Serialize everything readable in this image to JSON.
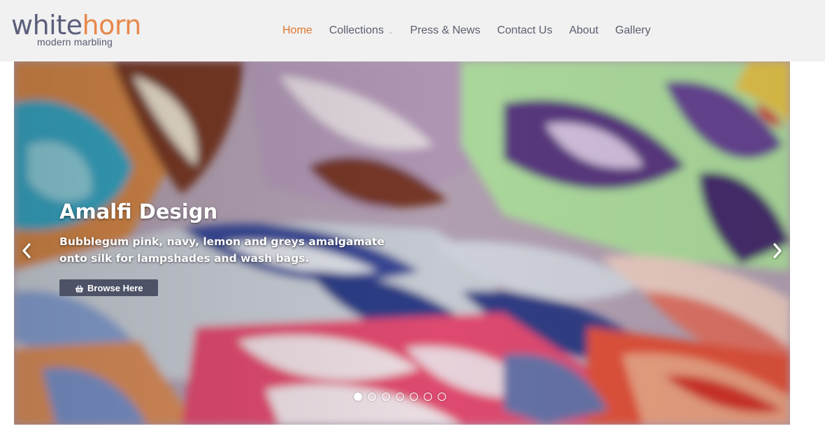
{
  "brand": {
    "name_part1": "white",
    "name_part2": "horn",
    "tagline": "modern marbling",
    "color_primary": "#5b5f7c",
    "color_accent": "#e8884a"
  },
  "nav": {
    "items": [
      {
        "label": "Home",
        "active": true
      },
      {
        "label": "Collections",
        "has_dropdown": true
      },
      {
        "label": "Press & News"
      },
      {
        "label": "Contact Us"
      },
      {
        "label": "About"
      },
      {
        "label": "Gallery"
      }
    ],
    "active_color": "#e0742e"
  },
  "slider": {
    "title": "Amalfi Design",
    "description": "Bubblegum pink, navy, lemon and greys amalgamate onto silk for lampshades and wash bags.",
    "button_label": "Browse Here",
    "button_icon": "basket-icon",
    "prev_icon": "chevron-left-icon",
    "next_icon": "chevron-right-icon",
    "slide_count": 7,
    "active_slide": 1
  }
}
